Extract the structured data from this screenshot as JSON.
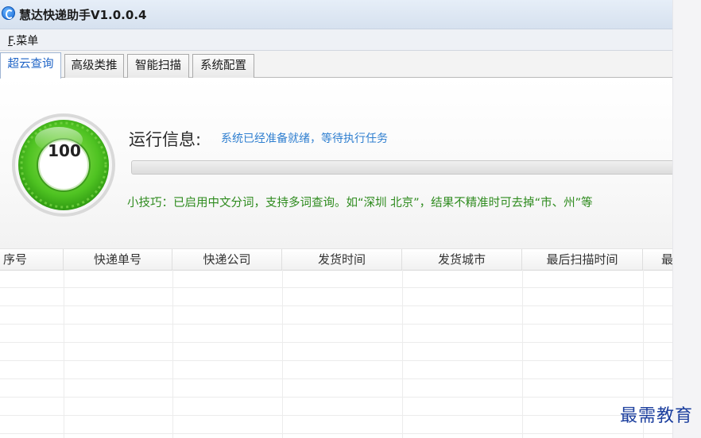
{
  "window": {
    "title": "慧达快递助手V1.0.0.4"
  },
  "menu": {
    "file_accel": "F",
    "file_label": ".菜单"
  },
  "tabs": [
    {
      "label": "超云查询",
      "active": true
    },
    {
      "label": "高级类推",
      "active": false
    },
    {
      "label": "智能扫描",
      "active": false
    },
    {
      "label": "系统配置",
      "active": false
    }
  ],
  "status": {
    "gauge_value": "100",
    "run_label": "运行信息:",
    "run_message": "系统已经准备就绪，等待执行任务",
    "progress_fraction": 0,
    "tip": "小技巧：已启用中文分词，支持多词查询。如“深圳 北京”，结果不精准时可去掉“市、州”等"
  },
  "table": {
    "columns": [
      "序号",
      "快递单号",
      "快递公司",
      "发货时间",
      "发货城市",
      "最后扫描时间",
      "最"
    ],
    "rows": []
  },
  "colors": {
    "accent": "#1e63c6",
    "tip_green": "#2e8b1e",
    "gauge_green": "#5ac928"
  },
  "watermark": "最需教育"
}
